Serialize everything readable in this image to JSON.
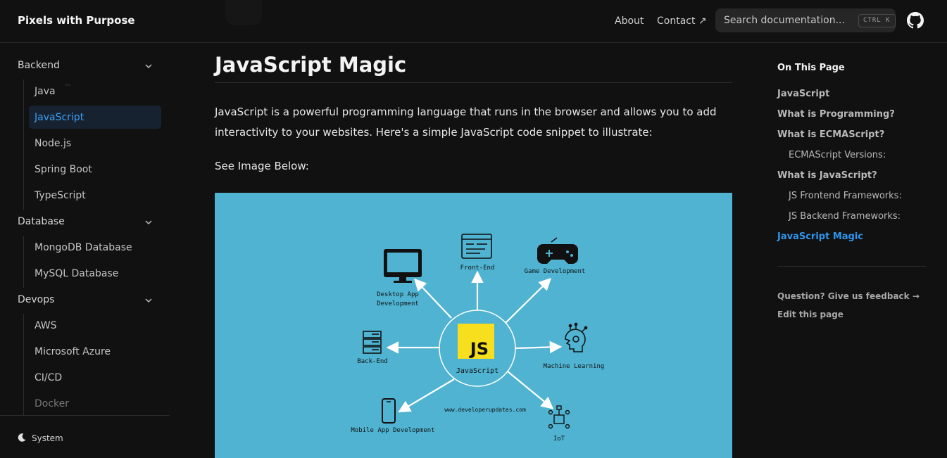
{
  "header": {
    "brand": "Pixels with Purpose",
    "nav": [
      {
        "label": "About"
      },
      {
        "label": "Contact ↗"
      }
    ],
    "search": {
      "placeholder": "Search documentation...",
      "shortcut": "CTRL K"
    }
  },
  "sidebar": {
    "groups": [
      {
        "label": "Backend",
        "items": [
          "Java",
          "JavaScript",
          "Node.js",
          "Spring Boot",
          "TypeScript"
        ]
      },
      {
        "label": "Database",
        "items": [
          "MongoDB Database",
          "MySQL Database"
        ]
      },
      {
        "label": "Devops",
        "items": [
          "AWS",
          "Microsoft Azure",
          "CI/CD",
          "Docker"
        ]
      }
    ],
    "active_item": "JavaScript",
    "theme_label": "System"
  },
  "main": {
    "title": "JavaScript Magic",
    "paragraph": "JavaScript is a powerful programming language that runs in the browser and allows you to add interactivity to your websites. Here's a simple JavaScript code snippet to illustrate:",
    "see_image": "See Image Below:",
    "figure": {
      "center_logo": "JS",
      "center_label": "JavaScript",
      "nodes": [
        "Front-End",
        "Game Development",
        "Desktop App Development",
        "Back-End",
        "Machine Learning",
        "Mobile App Development",
        "IoT"
      ],
      "website": "www.developerupdates.com",
      "bg_color": "#4fb3d1",
      "logo_color": "#f7df1e"
    }
  },
  "toc": {
    "title": "On This Page",
    "items": [
      {
        "label": "JavaScript",
        "level": 1
      },
      {
        "label": "What is Programming?",
        "level": 1
      },
      {
        "label": "What is ECMAScript?",
        "level": 1
      },
      {
        "label": "ECMAScript Versions:",
        "level": 2
      },
      {
        "label": "What is JavaScript?",
        "level": 1
      },
      {
        "label": "JS Frontend Frameworks:",
        "level": 2
      },
      {
        "label": "JS Backend Frameworks:",
        "level": 2
      },
      {
        "label": "JavaScript Magic",
        "level": 1,
        "active": true
      }
    ],
    "feedback": "Question? Give us feedback →",
    "edit": "Edit this page"
  },
  "colors": {
    "background": "#111111",
    "accent": "#2f95ee",
    "active_bg": "#172230"
  }
}
